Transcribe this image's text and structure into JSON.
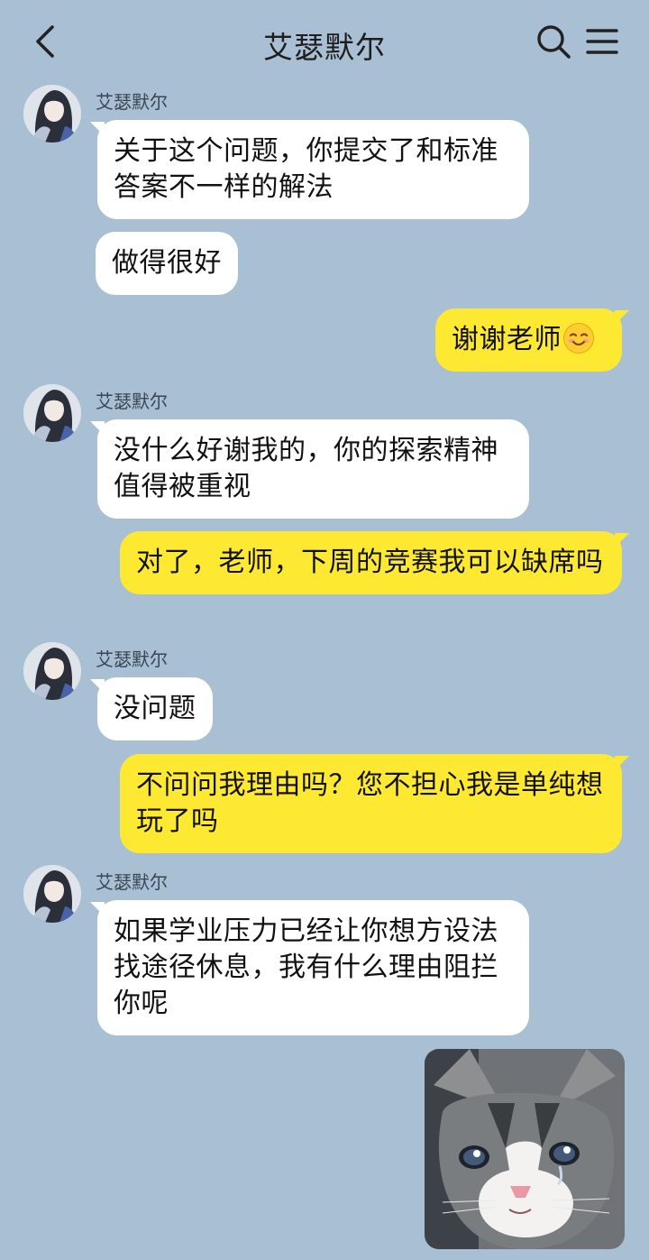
{
  "header": {
    "title": "艾瑟默尔"
  },
  "messages": [
    {
      "sender": "艾瑟默尔",
      "text": "关于这个问题，你提交了和标准答案不一样的解法"
    },
    {
      "text": "做得很好"
    },
    {
      "text": "谢谢老师",
      "emoji": "smiling-face-emoji"
    },
    {
      "sender": "艾瑟默尔",
      "text": "没什么好谢我的，你的探索精神值得被重视"
    },
    {
      "text": "对了，老师，下周的竞赛我可以缺席吗"
    },
    {
      "sender": "艾瑟默尔",
      "text": "没问题"
    },
    {
      "text": "不问问我理由吗？您不担心我是单纯想玩了吗"
    },
    {
      "sender": "艾瑟默尔",
      "text": "如果学业压力已经让你想方设法找途径休息，我有什么理由阻拦你呢"
    }
  ],
  "sticker": {
    "icon": "crying-cat-sticker"
  },
  "colors": {
    "background": "#a9bfd3",
    "incoming_bubble": "#ffffff",
    "outgoing_bubble": "#fde932"
  }
}
